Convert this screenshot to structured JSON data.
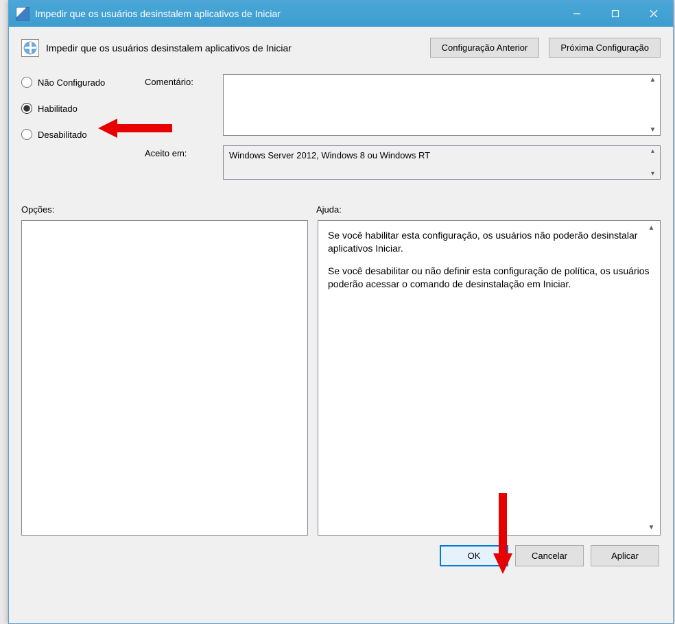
{
  "window": {
    "title": "Impedir que os usuários desinstalem aplicativos de Iniciar"
  },
  "header": {
    "policy_title": "Impedir que os usuários desinstalem aplicativos de Iniciar",
    "prev_button": "Configuração Anterior",
    "next_button": "Próxima Configuração"
  },
  "radios": {
    "not_configured": "Não Configurado",
    "enabled": "Habilitado",
    "disabled": "Desabilitado",
    "selected": "enabled"
  },
  "fields": {
    "comment_label": "Comentário:",
    "comment_value": "",
    "supported_label": "Aceito em:",
    "supported_value": "Windows Server 2012, Windows 8 ou Windows RT"
  },
  "sections": {
    "options_label": "Opções:",
    "help_label": "Ajuda:"
  },
  "help": {
    "para1": "Se você habilitar esta configuração, os usuários não poderão desinstalar aplicativos Iniciar.",
    "para2": "Se você desabilitar ou não definir esta configuração de política, os usuários poderão acessar o comando de desinstalação em Iniciar."
  },
  "footer": {
    "ok": "OK",
    "cancel": "Cancelar",
    "apply": "Aplicar"
  }
}
